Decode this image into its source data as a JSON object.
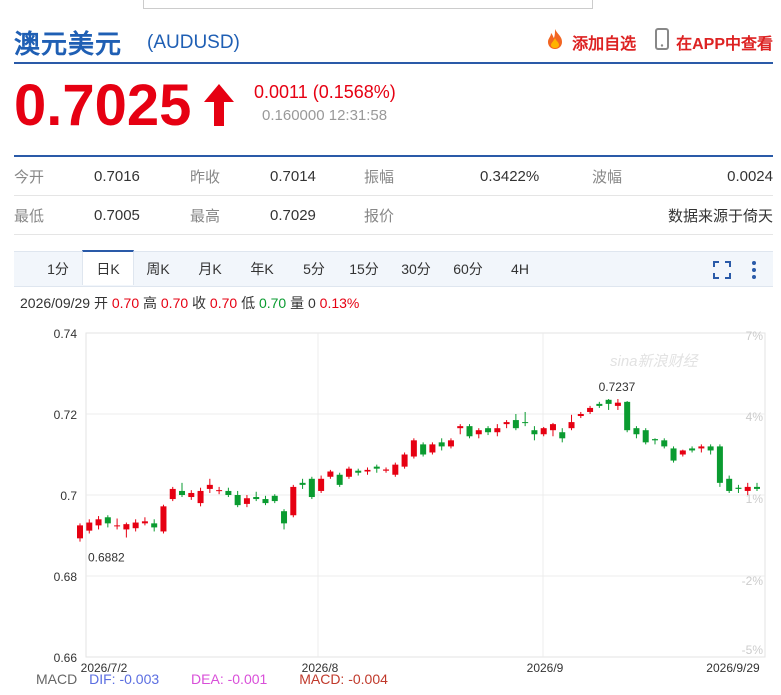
{
  "header": {
    "title_cn": "澳元美元",
    "code": "(AUDUSD)",
    "actions": [
      {
        "label": "添加自选",
        "icon": "fire-icon"
      },
      {
        "label": "在APP中查看",
        "icon": "phone-icon"
      }
    ]
  },
  "quote": {
    "price": "0.7025",
    "change": "0.0011 (0.1568%)",
    "updated": "0.160000 12:31:58",
    "direction_icon": "up-arrow-icon",
    "up_color": "#e60012"
  },
  "stats": {
    "rows": [
      [
        {
          "label": "今开",
          "value": "0.7016"
        },
        {
          "label": "昨收",
          "value": "0.7014"
        },
        {
          "label": "振幅",
          "value": "0.3422%"
        },
        {
          "label": "波幅",
          "value": "0.0024"
        }
      ],
      [
        {
          "label": "最低",
          "value": "0.7005"
        },
        {
          "label": "最高",
          "value": "0.7029"
        },
        {
          "label": "报价",
          "value": ""
        },
        {
          "label": "",
          "value": "数据来源于倚天"
        }
      ]
    ]
  },
  "tabs": [
    "1分",
    "日K",
    "周K",
    "月K",
    "年K",
    "5分",
    "15分",
    "30分",
    "60分",
    "4H"
  ],
  "active_tab": "日K",
  "toolbar_icons": [
    "fullscreen-icon",
    "more-vertical-icon"
  ],
  "ohlc": {
    "date": "2026/09/29",
    "open_label": "开",
    "open": "0.70",
    "high_label": "高",
    "high": "0.70",
    "close_label": "收",
    "close": "0.70",
    "low_label": "低",
    "low": "0.70",
    "vol_label": "量",
    "vol": "0",
    "pct": "0.13%"
  },
  "macd": {
    "label": "MACD",
    "dif": "DIF: -0.003",
    "dea": "DEA: -0.001",
    "macd": "MACD: -0.004",
    "dif_color": "#5b6ee1",
    "dea_color": "#d94fd9",
    "macd_color": "#c0392b"
  },
  "watermark": "sina新浪财经",
  "chart_data": {
    "type": "candlestick",
    "ylim": [
      0.66,
      0.74
    ],
    "yticks": [
      "0.74",
      "0.72",
      "0.7",
      "0.68",
      "0.66"
    ],
    "y2ticks": [
      "7%",
      "4%",
      "1%",
      "-2%",
      "-5%"
    ],
    "xlabels": [
      "2026/7/2",
      "2026/8",
      "2026/9",
      "2026/9/29"
    ],
    "min_label": "0.6882",
    "max_label": "0.7237",
    "grid": true,
    "up_color": "#e60012",
    "down_color": "#0a9b30",
    "candles": [
      [
        0.6893,
        0.6925,
        0.6885,
        0.693
      ],
      [
        0.6912,
        0.6932,
        0.6905,
        0.694
      ],
      [
        0.6925,
        0.694,
        0.6915,
        0.6948
      ],
      [
        0.6945,
        0.693,
        0.692,
        0.695
      ],
      [
        0.6925,
        0.6925,
        0.6915,
        0.6942
      ],
      [
        0.6915,
        0.6928,
        0.6895,
        0.6932
      ],
      [
        0.6918,
        0.6932,
        0.691,
        0.694
      ],
      [
        0.693,
        0.6935,
        0.6925,
        0.6945
      ],
      [
        0.693,
        0.692,
        0.691,
        0.694
      ],
      [
        0.691,
        0.6972,
        0.6905,
        0.6976
      ],
      [
        0.699,
        0.7015,
        0.6985,
        0.702
      ],
      [
        0.701,
        0.7,
        0.6995,
        0.703
      ],
      [
        0.6995,
        0.7005,
        0.6988,
        0.7012
      ],
      [
        0.698,
        0.701,
        0.6972,
        0.7018
      ],
      [
        0.7015,
        0.7025,
        0.7005,
        0.704
      ],
      [
        0.701,
        0.7012,
        0.7002,
        0.702
      ],
      [
        0.701,
        0.7,
        0.6995,
        0.7018
      ],
      [
        0.7,
        0.6975,
        0.697,
        0.701
      ],
      [
        0.6978,
        0.6992,
        0.697,
        0.7
      ],
      [
        0.6995,
        0.699,
        0.6985,
        0.7008
      ],
      [
        0.699,
        0.698,
        0.6975,
        0.6998
      ],
      [
        0.6998,
        0.6985,
        0.698,
        0.7002
      ],
      [
        0.696,
        0.693,
        0.6915,
        0.6965
      ],
      [
        0.695,
        0.702,
        0.6945,
        0.7025
      ],
      [
        0.703,
        0.7025,
        0.7015,
        0.704
      ],
      [
        0.704,
        0.6995,
        0.699,
        0.7045
      ],
      [
        0.701,
        0.704,
        0.7005,
        0.7048
      ],
      [
        0.7045,
        0.7058,
        0.704,
        0.7062
      ],
      [
        0.705,
        0.7025,
        0.702,
        0.7055
      ],
      [
        0.7045,
        0.7065,
        0.704,
        0.707
      ],
      [
        0.706,
        0.7055,
        0.7048,
        0.7065
      ],
      [
        0.7058,
        0.7062,
        0.705,
        0.7068
      ],
      [
        0.707,
        0.7065,
        0.7055,
        0.7075
      ],
      [
        0.706,
        0.7063,
        0.7055,
        0.7068
      ],
      [
        0.705,
        0.7075,
        0.7045,
        0.708
      ],
      [
        0.707,
        0.71,
        0.7065,
        0.7105
      ],
      [
        0.7095,
        0.7135,
        0.709,
        0.714
      ],
      [
        0.7125,
        0.71,
        0.7095,
        0.713
      ],
      [
        0.7105,
        0.7125,
        0.71,
        0.713
      ],
      [
        0.713,
        0.712,
        0.711,
        0.714
      ],
      [
        0.712,
        0.7135,
        0.7115,
        0.714
      ],
      [
        0.7165,
        0.717,
        0.715,
        0.7175
      ],
      [
        0.717,
        0.7145,
        0.714,
        0.7175
      ],
      [
        0.715,
        0.716,
        0.714,
        0.7165
      ],
      [
        0.7165,
        0.7155,
        0.7148,
        0.717
      ],
      [
        0.7155,
        0.7165,
        0.7145,
        0.7175
      ],
      [
        0.7175,
        0.718,
        0.7165,
        0.7185
      ],
      [
        0.7185,
        0.7165,
        0.716,
        0.72
      ],
      [
        0.718,
        0.7178,
        0.717,
        0.7205
      ],
      [
        0.716,
        0.715,
        0.7135,
        0.717
      ],
      [
        0.715,
        0.7165,
        0.7145,
        0.7168
      ],
      [
        0.716,
        0.7175,
        0.7145,
        0.7178
      ],
      [
        0.7155,
        0.714,
        0.713,
        0.7165
      ],
      [
        0.7165,
        0.718,
        0.716,
        0.7198
      ],
      [
        0.7195,
        0.72,
        0.719,
        0.7205
      ],
      [
        0.7205,
        0.7215,
        0.72,
        0.722
      ],
      [
        0.7225,
        0.722,
        0.7215,
        0.723
      ],
      [
        0.7235,
        0.7225,
        0.721,
        0.7237
      ],
      [
        0.722,
        0.7228,
        0.721,
        0.7237
      ],
      [
        0.723,
        0.716,
        0.7155,
        0.7232
      ],
      [
        0.7165,
        0.715,
        0.714,
        0.717
      ],
      [
        0.716,
        0.713,
        0.7125,
        0.7165
      ],
      [
        0.7138,
        0.7135,
        0.7125,
        0.714
      ],
      [
        0.7135,
        0.712,
        0.7115,
        0.714
      ],
      [
        0.7115,
        0.7085,
        0.708,
        0.712
      ],
      [
        0.71,
        0.711,
        0.7095,
        0.7112
      ],
      [
        0.7115,
        0.711,
        0.7105,
        0.712
      ],
      [
        0.7115,
        0.712,
        0.7105,
        0.7125
      ],
      [
        0.712,
        0.711,
        0.71,
        0.7125
      ],
      [
        0.712,
        0.703,
        0.702,
        0.7125
      ],
      [
        0.704,
        0.701,
        0.7005,
        0.7048
      ],
      [
        0.7018,
        0.7015,
        0.7005,
        0.7025
      ],
      [
        0.701,
        0.702,
        0.7,
        0.703
      ],
      [
        0.702,
        0.7015,
        0.701,
        0.703
      ]
    ]
  }
}
